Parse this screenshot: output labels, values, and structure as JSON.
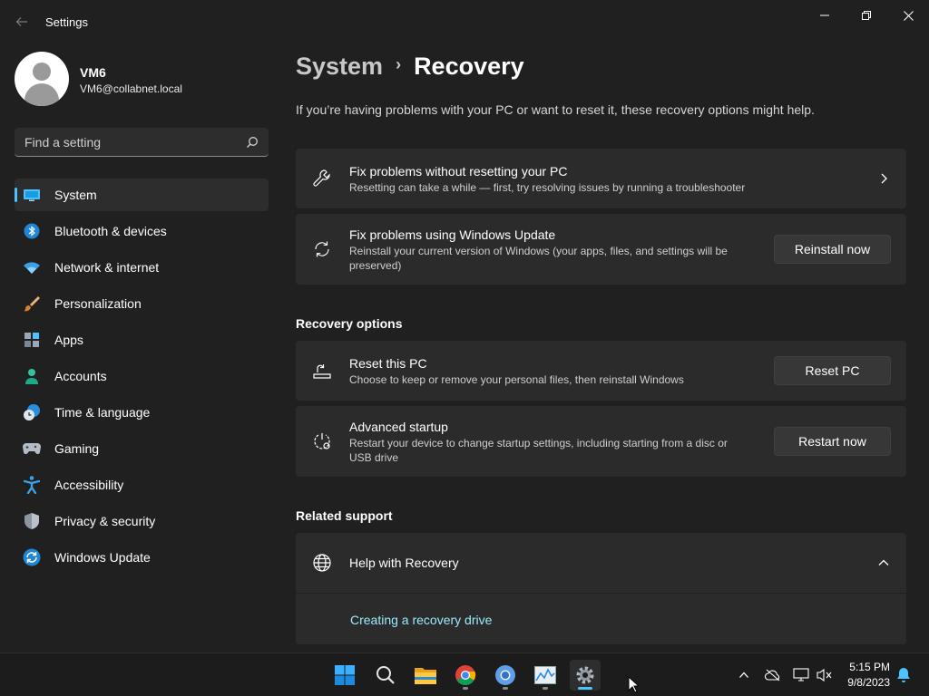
{
  "window": {
    "app_title": "Settings",
    "back_icon": "back-arrow-icon",
    "controls": [
      "minimize-icon",
      "maximize-icon",
      "close-icon"
    ]
  },
  "user": {
    "name": "VM6",
    "email": "VM6@collabnet.local"
  },
  "search": {
    "placeholder": "Find a setting"
  },
  "sidebar": {
    "items": [
      {
        "label": "System",
        "icon": "system-icon",
        "active": true
      },
      {
        "label": "Bluetooth & devices",
        "icon": "bluetooth-icon",
        "active": false
      },
      {
        "label": "Network & internet",
        "icon": "wifi-icon",
        "active": false
      },
      {
        "label": "Personalization",
        "icon": "brush-icon",
        "active": false
      },
      {
        "label": "Apps",
        "icon": "apps-icon",
        "active": false
      },
      {
        "label": "Accounts",
        "icon": "accounts-icon",
        "active": false
      },
      {
        "label": "Time & language",
        "icon": "clock-globe-icon",
        "active": false
      },
      {
        "label": "Gaming",
        "icon": "gamepad-icon",
        "active": false
      },
      {
        "label": "Accessibility",
        "icon": "accessibility-icon",
        "active": false
      },
      {
        "label": "Privacy & security",
        "icon": "shield-icon",
        "active": false
      },
      {
        "label": "Windows Update",
        "icon": "windows-update-icon",
        "active": false
      }
    ]
  },
  "main": {
    "breadcrumb": {
      "parent": "System",
      "separator": "›",
      "current": "Recovery"
    },
    "intro": "If you’re having problems with your PC or want to reset it, these recovery options might help.",
    "fix_no_reset": {
      "title": "Fix problems without resetting your PC",
      "description": "Resetting can take a while — first, try resolving issues by running a troubleshooter"
    },
    "fix_update": {
      "title": "Fix problems using Windows Update",
      "description": "Reinstall your current version of Windows (your apps, files, and settings will be preserved)",
      "button": "Reinstall now"
    },
    "recovery_options_title": "Recovery options",
    "reset_pc": {
      "title": "Reset this PC",
      "description": "Choose to keep or remove your personal files, then reinstall Windows",
      "button": "Reset PC"
    },
    "advanced_startup": {
      "title": "Advanced startup",
      "description": "Restart your device to change startup settings, including starting from a disc or USB drive",
      "button": "Restart now"
    },
    "related_support_title": "Related support",
    "help": {
      "title": "Help with Recovery",
      "link": "Creating a recovery drive"
    }
  },
  "taskbar": {
    "apps": [
      "windows-start-icon",
      "search-icon",
      "file-explorer-icon",
      "chrome-icon",
      "chrome-alt-icon",
      "task-manager-icon",
      "settings-gear-icon"
    ],
    "tray_icons": [
      "chevron-up-icon",
      "onedrive-offline-icon",
      "network-icon",
      "volume-muted-icon",
      "notification-bell-icon"
    ],
    "time": "5:15 PM",
    "date": "9/8/2023"
  },
  "colors": {
    "background": "#202020",
    "card": "#2b2b2b",
    "accent": "#4cc2ff",
    "link": "#99ebff"
  }
}
